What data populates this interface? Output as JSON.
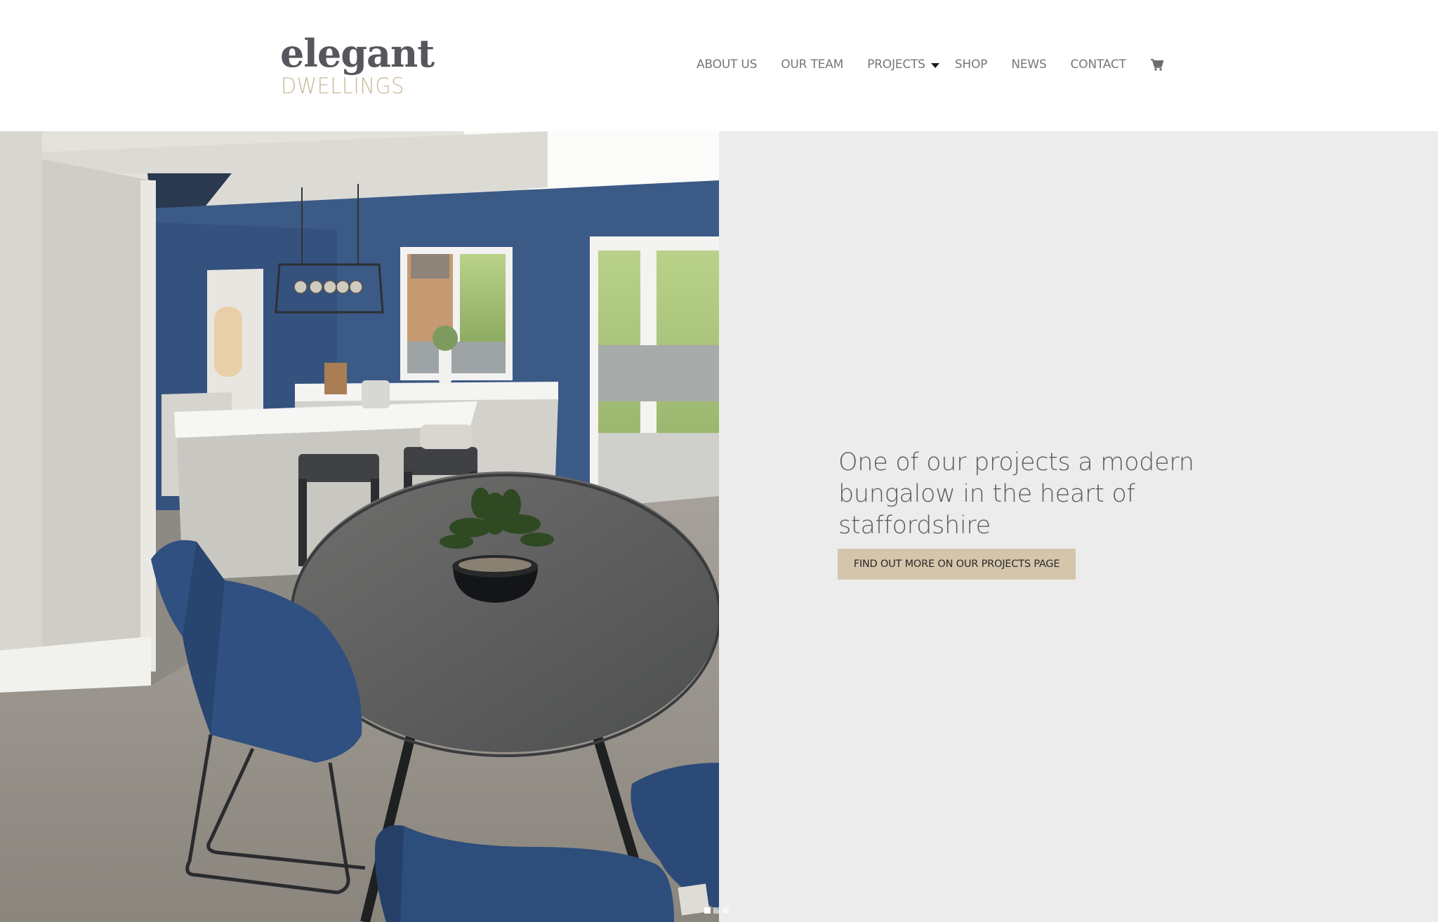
{
  "brand": {
    "name_top": "elegant",
    "name_bottom": "DWELLINGS",
    "colors": {
      "dark": "#55575c",
      "gold": "#c9b89b"
    }
  },
  "nav": {
    "items": [
      {
        "label": "ABOUT US"
      },
      {
        "label": "OUR TEAM"
      },
      {
        "label": "PROJECTS",
        "has_dropdown": true
      },
      {
        "label": "SHOP"
      },
      {
        "label": "NEWS"
      },
      {
        "label": "CONTACT"
      }
    ],
    "cart_icon": "shopping-cart-icon"
  },
  "hero": {
    "image_alt": "Modern kitchen with navy blue walls, white island with bar stools, round grey dining table with blue upholstered chairs and a potted plant",
    "heading": "One of our projects a modern bungalow in the heart of staffordshire",
    "button_label": "FIND OUT MORE ON OUR PROJECTS PAGE",
    "button_color": "#d5c5ab",
    "panel_color": "#ececec",
    "slides": {
      "count": 3,
      "active": 1
    }
  }
}
